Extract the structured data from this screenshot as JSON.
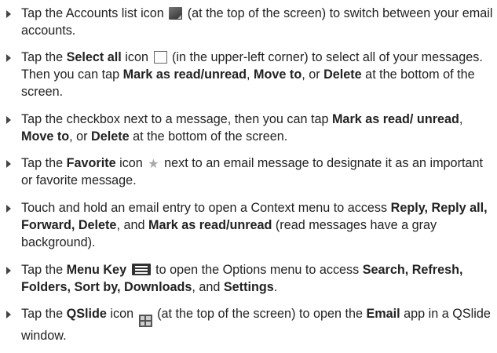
{
  "items": [
    {
      "parts": [
        {
          "t": "Tap the Accounts list icon "
        },
        {
          "icon": "accounts-list-icon"
        },
        {
          "t": " (at the top of the screen) to switch between your email accounts."
        }
      ]
    },
    {
      "parts": [
        {
          "t": "Tap the "
        },
        {
          "t": "Select all",
          "b": true
        },
        {
          "t": " icon "
        },
        {
          "icon": "select-all-checkbox-icon"
        },
        {
          "t": " (in the upper-left corner) to select all of your messages. Then you can tap "
        },
        {
          "t": "Mark as read/unread",
          "b": true
        },
        {
          "t": ", "
        },
        {
          "t": "Move to",
          "b": true
        },
        {
          "t": ", or "
        },
        {
          "t": "Delete",
          "b": true
        },
        {
          "t": " at the bottom of the screen."
        }
      ]
    },
    {
      "parts": [
        {
          "t": "Tap the checkbox next to a message, then you can tap "
        },
        {
          "t": "Mark as read/ unread",
          "b": true
        },
        {
          "t": ", "
        },
        {
          "t": "Move to",
          "b": true
        },
        {
          "t": ", or "
        },
        {
          "t": "Delete",
          "b": true
        },
        {
          "t": " at the bottom of the screen."
        }
      ]
    },
    {
      "parts": [
        {
          "t": "Tap the "
        },
        {
          "t": "Favorite",
          "b": true
        },
        {
          "t": " icon "
        },
        {
          "icon": "favorite-star-icon"
        },
        {
          "t": " next to an email message to designate it as an important or favorite message."
        }
      ]
    },
    {
      "parts": [
        {
          "t": "Touch and hold an email entry to open a Context menu to access "
        },
        {
          "t": "Reply, Reply all, Forward, Delete",
          "b": true
        },
        {
          "t": ", and "
        },
        {
          "t": "Mark as read/unread",
          "b": true
        },
        {
          "t": " (read messages have a gray background)."
        }
      ]
    },
    {
      "parts": [
        {
          "t": "Tap the "
        },
        {
          "t": "Menu Key",
          "b": true
        },
        {
          "t": " "
        },
        {
          "icon": "menu-key-icon"
        },
        {
          "t": " to open the Options menu to access "
        },
        {
          "t": "Search, Refresh, Folders, Sort by, Downloads",
          "b": true
        },
        {
          "t": ", and "
        },
        {
          "t": "Settings",
          "b": true
        },
        {
          "t": "."
        }
      ]
    },
    {
      "parts": [
        {
          "t": "Tap the "
        },
        {
          "t": "QSlide",
          "b": true
        },
        {
          "t": " icon "
        },
        {
          "icon": "qslide-icon"
        },
        {
          "t": " (at the top of the screen) to open the "
        },
        {
          "t": "Email",
          "b": true
        },
        {
          "t": " app in a QSlide window."
        }
      ]
    }
  ]
}
